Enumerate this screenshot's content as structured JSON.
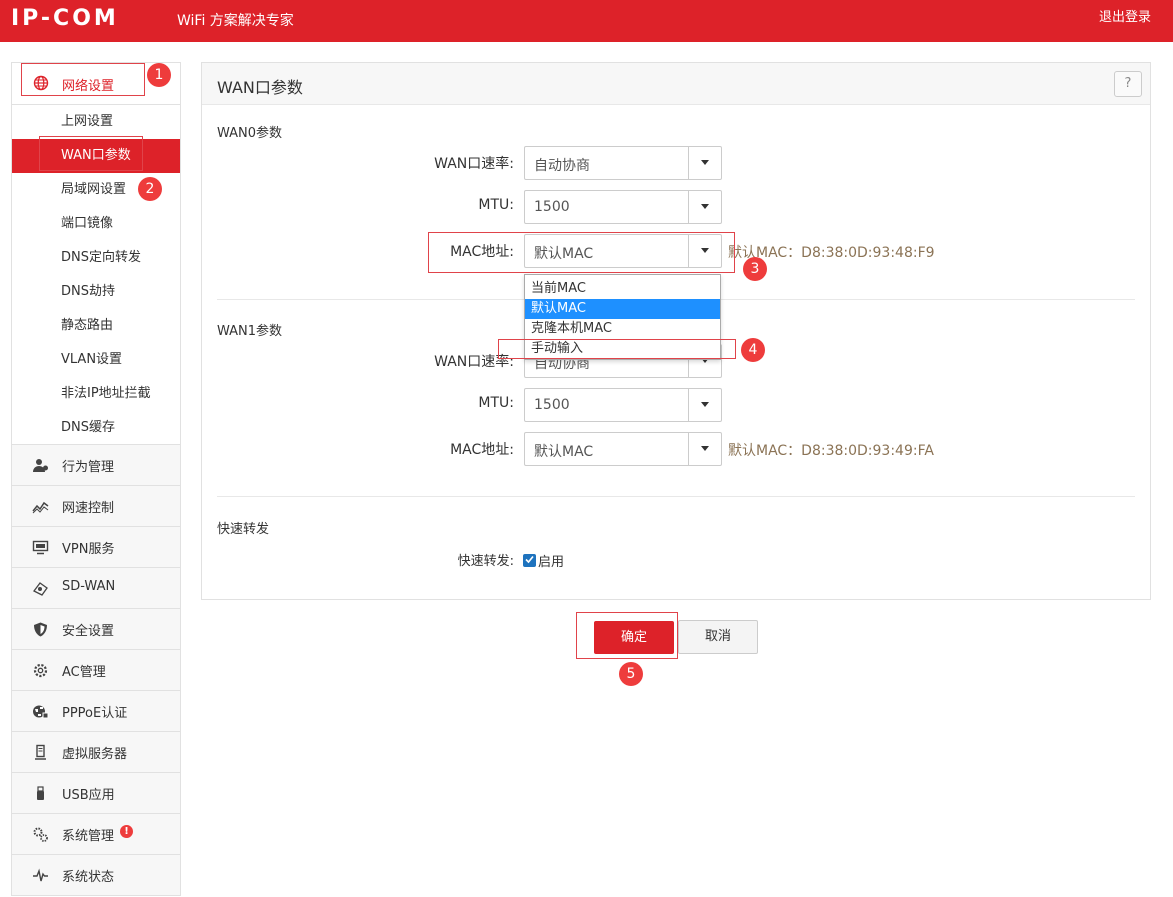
{
  "header": {
    "logo": "IP-COM",
    "slogan": "WiFi 方案解决专家",
    "logout_label": "退出登录"
  },
  "sidebar": {
    "top_group": {
      "label": "网络设置",
      "icon": "globe-icon"
    },
    "sub_items": [
      {
        "label": "上网设置"
      },
      {
        "label": "WAN口参数",
        "active": true
      },
      {
        "label": "局域网设置"
      },
      {
        "label": "端口镜像"
      },
      {
        "label": "DNS定向转发"
      },
      {
        "label": "DNS劫持"
      },
      {
        "label": "静态路由"
      },
      {
        "label": "VLAN设置"
      },
      {
        "label": "非法IP地址拦截"
      },
      {
        "label": "DNS缓存"
      }
    ],
    "groups": [
      {
        "label": "行为管理",
        "icon": "user-behavior-icon"
      },
      {
        "label": "网速控制",
        "icon": "speed-chart-icon"
      },
      {
        "label": "VPN服务",
        "icon": "monitor-icon"
      },
      {
        "label": "SD-WAN",
        "icon": "network-cloud-icon"
      },
      {
        "label": "安全设置",
        "icon": "shield-icon"
      },
      {
        "label": "AC管理",
        "icon": "gear-cog-icon"
      },
      {
        "label": "PPPoE认证",
        "icon": "globe-key-icon"
      },
      {
        "label": "虚拟服务器",
        "icon": "server-icon"
      },
      {
        "label": "USB应用",
        "icon": "usb-icon"
      },
      {
        "label": "系统管理",
        "icon": "gears-icon",
        "alert": "!"
      },
      {
        "label": "系统状态",
        "icon": "pulse-icon"
      }
    ]
  },
  "panel": {
    "title": "WAN口参数",
    "help_label": "?",
    "wan0": {
      "section": "WAN0参数",
      "speed_label": "WAN口速率:",
      "speed_value": "自动协商",
      "mtu_label": "MTU:",
      "mtu_value": "1500",
      "mac_label": "MAC地址:",
      "mac_value": "默认MAC",
      "mac_note": "默认MAC：D8:38:0D:93:48:F9"
    },
    "dropdown": [
      "当前MAC",
      "默认MAC",
      "克隆本机MAC",
      "手动输入"
    ],
    "wan1": {
      "section": "WAN1参数",
      "speed_label": "WAN口速率:",
      "speed_value": "自动协商",
      "mtu_label": "MTU:",
      "mtu_value": "1500",
      "mac_label": "MAC地址:",
      "mac_value": "默认MAC",
      "mac_note": "默认MAC：D8:38:0D:93:49:FA"
    },
    "fast_forward": {
      "section": "快速转发",
      "label": "快速转发:",
      "option": "启用",
      "checked": true
    }
  },
  "buttons": {
    "ok": "确定",
    "cancel": "取消"
  },
  "annotations": [
    "1",
    "2",
    "3",
    "4",
    "5"
  ],
  "colors": {
    "brand": "#dd2229",
    "selection": "#1e90ff",
    "annotation": "#ee3c3c"
  }
}
